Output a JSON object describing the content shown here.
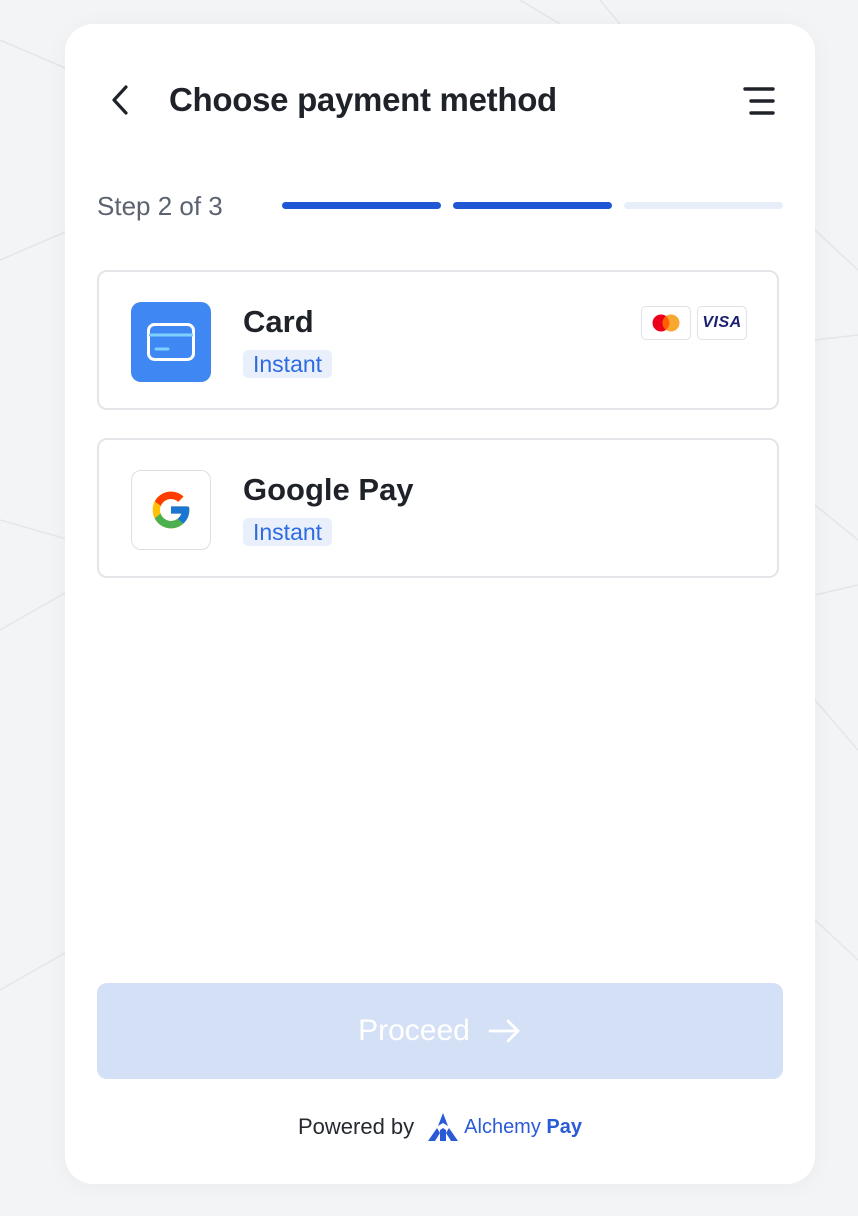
{
  "header": {
    "title": "Choose payment method",
    "back_icon": "chevron-left-icon",
    "menu_icon": "menu-icon"
  },
  "steps": {
    "label": "Step 2 of 3",
    "current": 2,
    "total": 3
  },
  "methods": [
    {
      "name": "Card",
      "badge": "Instant",
      "icon": "credit-card-icon",
      "brands": [
        "mastercard-icon",
        "VISA"
      ]
    },
    {
      "name": "Google Pay",
      "badge": "Instant",
      "icon": "google-icon"
    }
  ],
  "proceed": {
    "label": "Proceed",
    "icon": "arrow-right-icon",
    "enabled": false
  },
  "footer": {
    "powered_by": "Powered by",
    "brand_name": "Alchemy",
    "brand_suffix": "Pay"
  },
  "colors": {
    "primary": "#2057d4",
    "card_icon_bg": "#3f87f3",
    "badge_bg": "#e9f0fc",
    "badge_text": "#2e6ae0",
    "proceed_disabled_bg": "#d4e0f6",
    "progress_inactive": "#e8eef8"
  }
}
